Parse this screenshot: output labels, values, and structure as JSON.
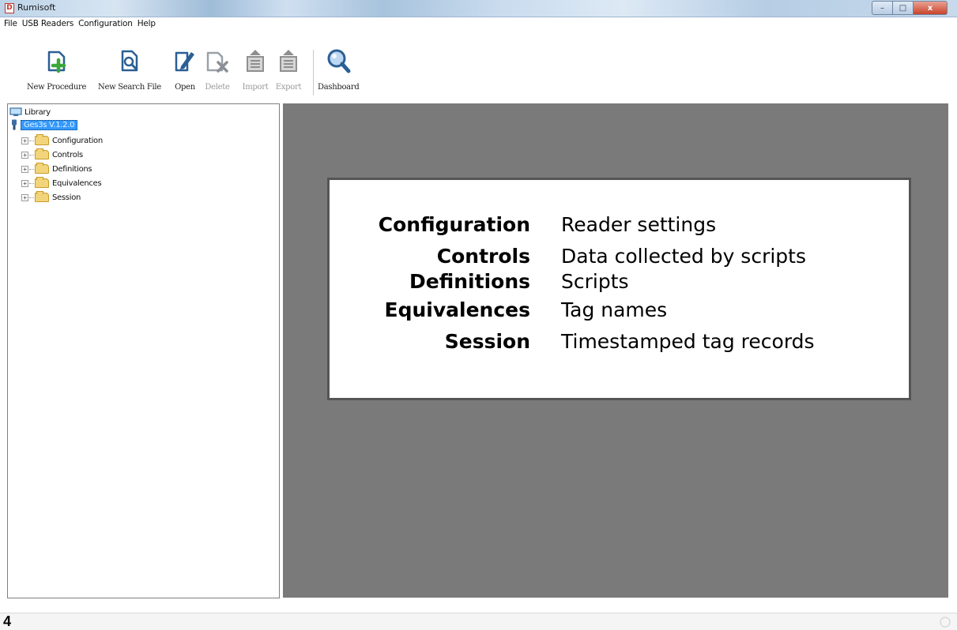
{
  "window": {
    "title": "Rumisoft",
    "app_icon_glyph": "D",
    "controls": {
      "minimize": "–",
      "maximize": "□",
      "close": "x"
    }
  },
  "menu": [
    "File",
    "USB Readers",
    "Configuration",
    "Help"
  ],
  "toolbar": {
    "buttons": [
      {
        "label": "New Procedure",
        "icon": "add-document-icon",
        "enabled": true
      },
      {
        "label": "New Search File",
        "icon": "search-document-icon",
        "enabled": true
      },
      {
        "label": "Open",
        "icon": "edit-document-icon",
        "enabled": true
      },
      {
        "label": "Delete",
        "icon": "delete-document-icon",
        "enabled": false
      },
      {
        "label": "Import",
        "icon": "import-icon",
        "enabled": false
      },
      {
        "label": "Export",
        "icon": "export-icon",
        "enabled": false
      },
      {
        "label": "Dashboard",
        "icon": "magnifier-icon",
        "enabled": true
      }
    ]
  },
  "tree": {
    "root": "Library",
    "device": "Ges3s V.1.2.0",
    "expander": "+",
    "folders": [
      "Configuration",
      "Controls",
      "Definitions",
      "Equivalences",
      "Session"
    ]
  },
  "info": {
    "rows": [
      {
        "key": "Configuration",
        "value": "Reader settings"
      },
      {
        "key": "Controls",
        "value": "Data collected by scripts"
      },
      {
        "key": "Definitions",
        "value": "Scripts"
      },
      {
        "key": "Equivalences",
        "value": "Tag names"
      },
      {
        "key": "Session",
        "value": "Timestamped tag records"
      }
    ]
  },
  "footer": {
    "page_number": "4"
  },
  "colors": {
    "selection": "#3399ff",
    "workspace_gray": "#7a7a7a",
    "accent_green": "#3aa83a",
    "icon_blue": "#2a5f95"
  }
}
